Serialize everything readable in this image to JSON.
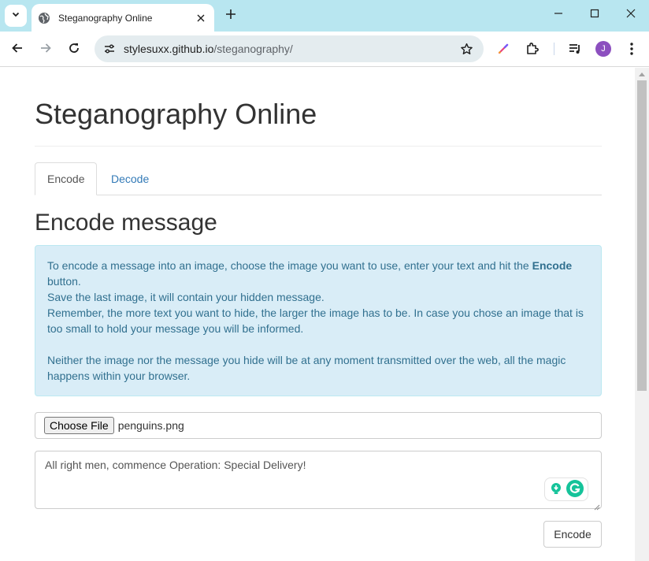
{
  "browser": {
    "tab_title": "Steganography Online",
    "url_host": "stylesuxx.github.io",
    "url_path": "/steganography/",
    "profile_initial": "J",
    "colors": {
      "tabstrip": "#b8e6f0",
      "omnibox": "#e4ecef",
      "avatar": "#8c4fbf"
    }
  },
  "page": {
    "title": "Steganography Online",
    "tabs": [
      {
        "label": "Encode",
        "active": true
      },
      {
        "label": "Decode",
        "active": false
      }
    ],
    "section_title": "Encode message",
    "info": {
      "line1_pre": "To encode a message into an image, choose the image you want to use, enter your text and hit the ",
      "line1_bold": "Encode",
      "line1_post": " button.",
      "line2": "Save the last image, it will contain your hidden message.",
      "line3": "Remember, the more text you want to hide, the larger the image has to be. In case you chose an image that is too small to hold your message you will be informed.",
      "line4": "Neither the image nor the message you hide will be at any moment transmitted over the web, all the magic happens within your browser."
    },
    "file_input": {
      "button_label": "Choose File",
      "file_name": "penguins.png"
    },
    "message": "All right men, commence Operation: Special Delivery!",
    "encode_button": "Encode",
    "colors": {
      "info_bg": "#d9edf7",
      "info_text": "#31708f",
      "link": "#337ab7",
      "grammarly": "#15c39a"
    }
  }
}
